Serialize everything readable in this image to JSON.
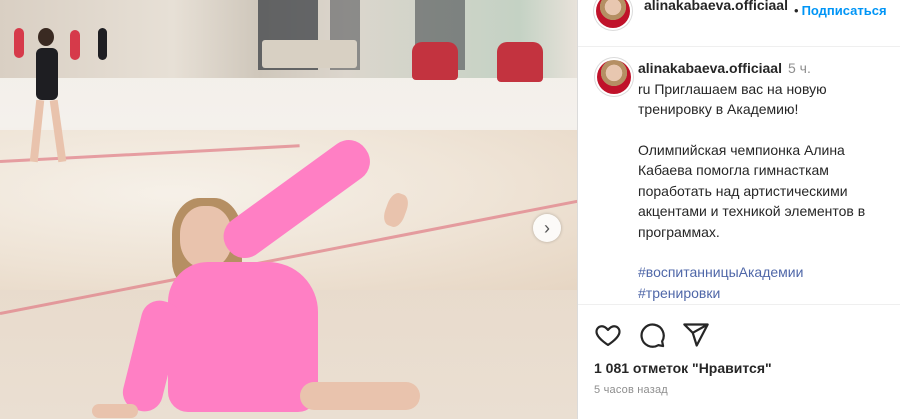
{
  "post": {
    "username_header": "alinakabaeva.officiaal",
    "follow_label": "Подписаться",
    "follow_separator": "•",
    "caption": {
      "username": "alinakabaeva.officiaal",
      "time_short": "5 ч.",
      "line1": "ru Приглашаем вас на новую тренировку в Академию!",
      "paragraph2": "Олимпийская чемпионка Алина Кабаева помогла гимнасткам поработать над артистическими акцентами и техникой элементов в программах.",
      "hashtags": [
        "#воспитанницыАкадемии",
        "#тренировки"
      ]
    },
    "likes_text": "1 081 отметок \"Нравится\"",
    "time_ago": "5 часов назад"
  },
  "colors": {
    "link_blue": "#0095f6",
    "hashtag": "#4f67a8",
    "text": "#262626",
    "muted": "#8e8e8e",
    "sweater_pink": "#ff7fc4"
  },
  "icons": [
    "heart-icon",
    "comment-icon",
    "share-icon",
    "chevron-right-icon"
  ]
}
